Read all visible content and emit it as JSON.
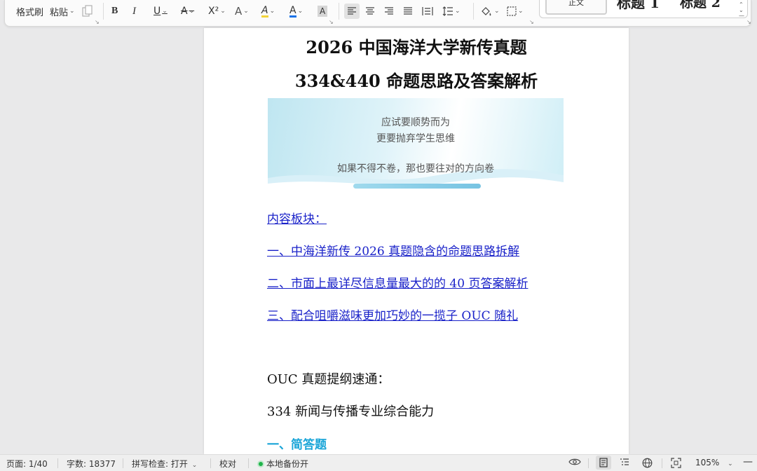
{
  "ribbon": {
    "format_painter": "格式刷",
    "paste": "粘贴",
    "bold": "B",
    "italic": "I",
    "underline": "U",
    "strikethrough": "A",
    "superscript": "X²",
    "text_effect": "A",
    "highlight": "A",
    "font_color": "A",
    "char_shading": "A",
    "font_color_hex": "#1a73e8",
    "styles": {
      "normal": "正文",
      "heading1": "标题 1",
      "heading2": "标题 2"
    }
  },
  "document": {
    "title_line1": "2026 中国海洋大学新传真题",
    "title_line2": "334&440 命题思路及答案解析",
    "banner": {
      "line1": "应试要顺势而为",
      "line2": "更要抛弃学生思维",
      "line3": "如果不得不卷，那也要往对的方向卷"
    },
    "toc_heading": "内容板块：",
    "toc_items": [
      "一、中海洋新传 2026 真题隐含的命题思路拆解",
      "二、市面上最详尽信息量最大的的 40 页答案解析",
      "三、配合咀嚼滋味更加巧妙的一揽子 OUC 随礼"
    ],
    "outline_title": "OUC 真题提纲速通：",
    "subject_title": "334 新闻与传播专业综合能力",
    "section_title": "一、简答题"
  },
  "status_bar": {
    "page": "页面: 1/40",
    "word_count": "字数: 18377",
    "spell_check": "拼写检查: 打开",
    "proofread": "校对",
    "backup": "本地备份开",
    "zoom": "105%"
  }
}
